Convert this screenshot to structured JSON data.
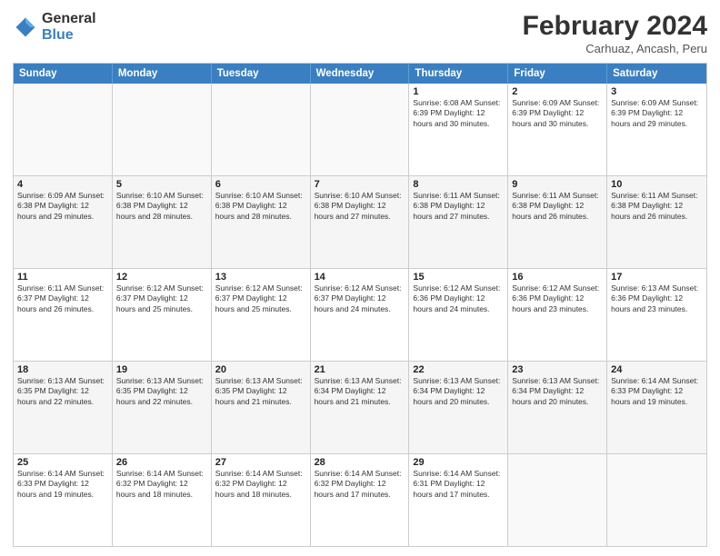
{
  "logo": {
    "general": "General",
    "blue": "Blue"
  },
  "header": {
    "month": "February 2024",
    "location": "Carhuaz, Ancash, Peru"
  },
  "weekdays": [
    "Sunday",
    "Monday",
    "Tuesday",
    "Wednesday",
    "Thursday",
    "Friday",
    "Saturday"
  ],
  "rows": [
    {
      "cells": [
        {
          "day": "",
          "info": ""
        },
        {
          "day": "",
          "info": ""
        },
        {
          "day": "",
          "info": ""
        },
        {
          "day": "",
          "info": ""
        },
        {
          "day": "1",
          "info": "Sunrise: 6:08 AM\nSunset: 6:39 PM\nDaylight: 12 hours and 30 minutes."
        },
        {
          "day": "2",
          "info": "Sunrise: 6:09 AM\nSunset: 6:39 PM\nDaylight: 12 hours and 30 minutes."
        },
        {
          "day": "3",
          "info": "Sunrise: 6:09 AM\nSunset: 6:39 PM\nDaylight: 12 hours and 29 minutes."
        }
      ]
    },
    {
      "cells": [
        {
          "day": "4",
          "info": "Sunrise: 6:09 AM\nSunset: 6:38 PM\nDaylight: 12 hours and 29 minutes."
        },
        {
          "day": "5",
          "info": "Sunrise: 6:10 AM\nSunset: 6:38 PM\nDaylight: 12 hours and 28 minutes."
        },
        {
          "day": "6",
          "info": "Sunrise: 6:10 AM\nSunset: 6:38 PM\nDaylight: 12 hours and 28 minutes."
        },
        {
          "day": "7",
          "info": "Sunrise: 6:10 AM\nSunset: 6:38 PM\nDaylight: 12 hours and 27 minutes."
        },
        {
          "day": "8",
          "info": "Sunrise: 6:11 AM\nSunset: 6:38 PM\nDaylight: 12 hours and 27 minutes."
        },
        {
          "day": "9",
          "info": "Sunrise: 6:11 AM\nSunset: 6:38 PM\nDaylight: 12 hours and 26 minutes."
        },
        {
          "day": "10",
          "info": "Sunrise: 6:11 AM\nSunset: 6:38 PM\nDaylight: 12 hours and 26 minutes."
        }
      ]
    },
    {
      "cells": [
        {
          "day": "11",
          "info": "Sunrise: 6:11 AM\nSunset: 6:37 PM\nDaylight: 12 hours and 26 minutes."
        },
        {
          "day": "12",
          "info": "Sunrise: 6:12 AM\nSunset: 6:37 PM\nDaylight: 12 hours and 25 minutes."
        },
        {
          "day": "13",
          "info": "Sunrise: 6:12 AM\nSunset: 6:37 PM\nDaylight: 12 hours and 25 minutes."
        },
        {
          "day": "14",
          "info": "Sunrise: 6:12 AM\nSunset: 6:37 PM\nDaylight: 12 hours and 24 minutes."
        },
        {
          "day": "15",
          "info": "Sunrise: 6:12 AM\nSunset: 6:36 PM\nDaylight: 12 hours and 24 minutes."
        },
        {
          "day": "16",
          "info": "Sunrise: 6:12 AM\nSunset: 6:36 PM\nDaylight: 12 hours and 23 minutes."
        },
        {
          "day": "17",
          "info": "Sunrise: 6:13 AM\nSunset: 6:36 PM\nDaylight: 12 hours and 23 minutes."
        }
      ]
    },
    {
      "cells": [
        {
          "day": "18",
          "info": "Sunrise: 6:13 AM\nSunset: 6:35 PM\nDaylight: 12 hours and 22 minutes."
        },
        {
          "day": "19",
          "info": "Sunrise: 6:13 AM\nSunset: 6:35 PM\nDaylight: 12 hours and 22 minutes."
        },
        {
          "day": "20",
          "info": "Sunrise: 6:13 AM\nSunset: 6:35 PM\nDaylight: 12 hours and 21 minutes."
        },
        {
          "day": "21",
          "info": "Sunrise: 6:13 AM\nSunset: 6:34 PM\nDaylight: 12 hours and 21 minutes."
        },
        {
          "day": "22",
          "info": "Sunrise: 6:13 AM\nSunset: 6:34 PM\nDaylight: 12 hours and 20 minutes."
        },
        {
          "day": "23",
          "info": "Sunrise: 6:13 AM\nSunset: 6:34 PM\nDaylight: 12 hours and 20 minutes."
        },
        {
          "day": "24",
          "info": "Sunrise: 6:14 AM\nSunset: 6:33 PM\nDaylight: 12 hours and 19 minutes."
        }
      ]
    },
    {
      "cells": [
        {
          "day": "25",
          "info": "Sunrise: 6:14 AM\nSunset: 6:33 PM\nDaylight: 12 hours and 19 minutes."
        },
        {
          "day": "26",
          "info": "Sunrise: 6:14 AM\nSunset: 6:32 PM\nDaylight: 12 hours and 18 minutes."
        },
        {
          "day": "27",
          "info": "Sunrise: 6:14 AM\nSunset: 6:32 PM\nDaylight: 12 hours and 18 minutes."
        },
        {
          "day": "28",
          "info": "Sunrise: 6:14 AM\nSunset: 6:32 PM\nDaylight: 12 hours and 17 minutes."
        },
        {
          "day": "29",
          "info": "Sunrise: 6:14 AM\nSunset: 6:31 PM\nDaylight: 12 hours and 17 minutes."
        },
        {
          "day": "",
          "info": ""
        },
        {
          "day": "",
          "info": ""
        }
      ]
    }
  ]
}
